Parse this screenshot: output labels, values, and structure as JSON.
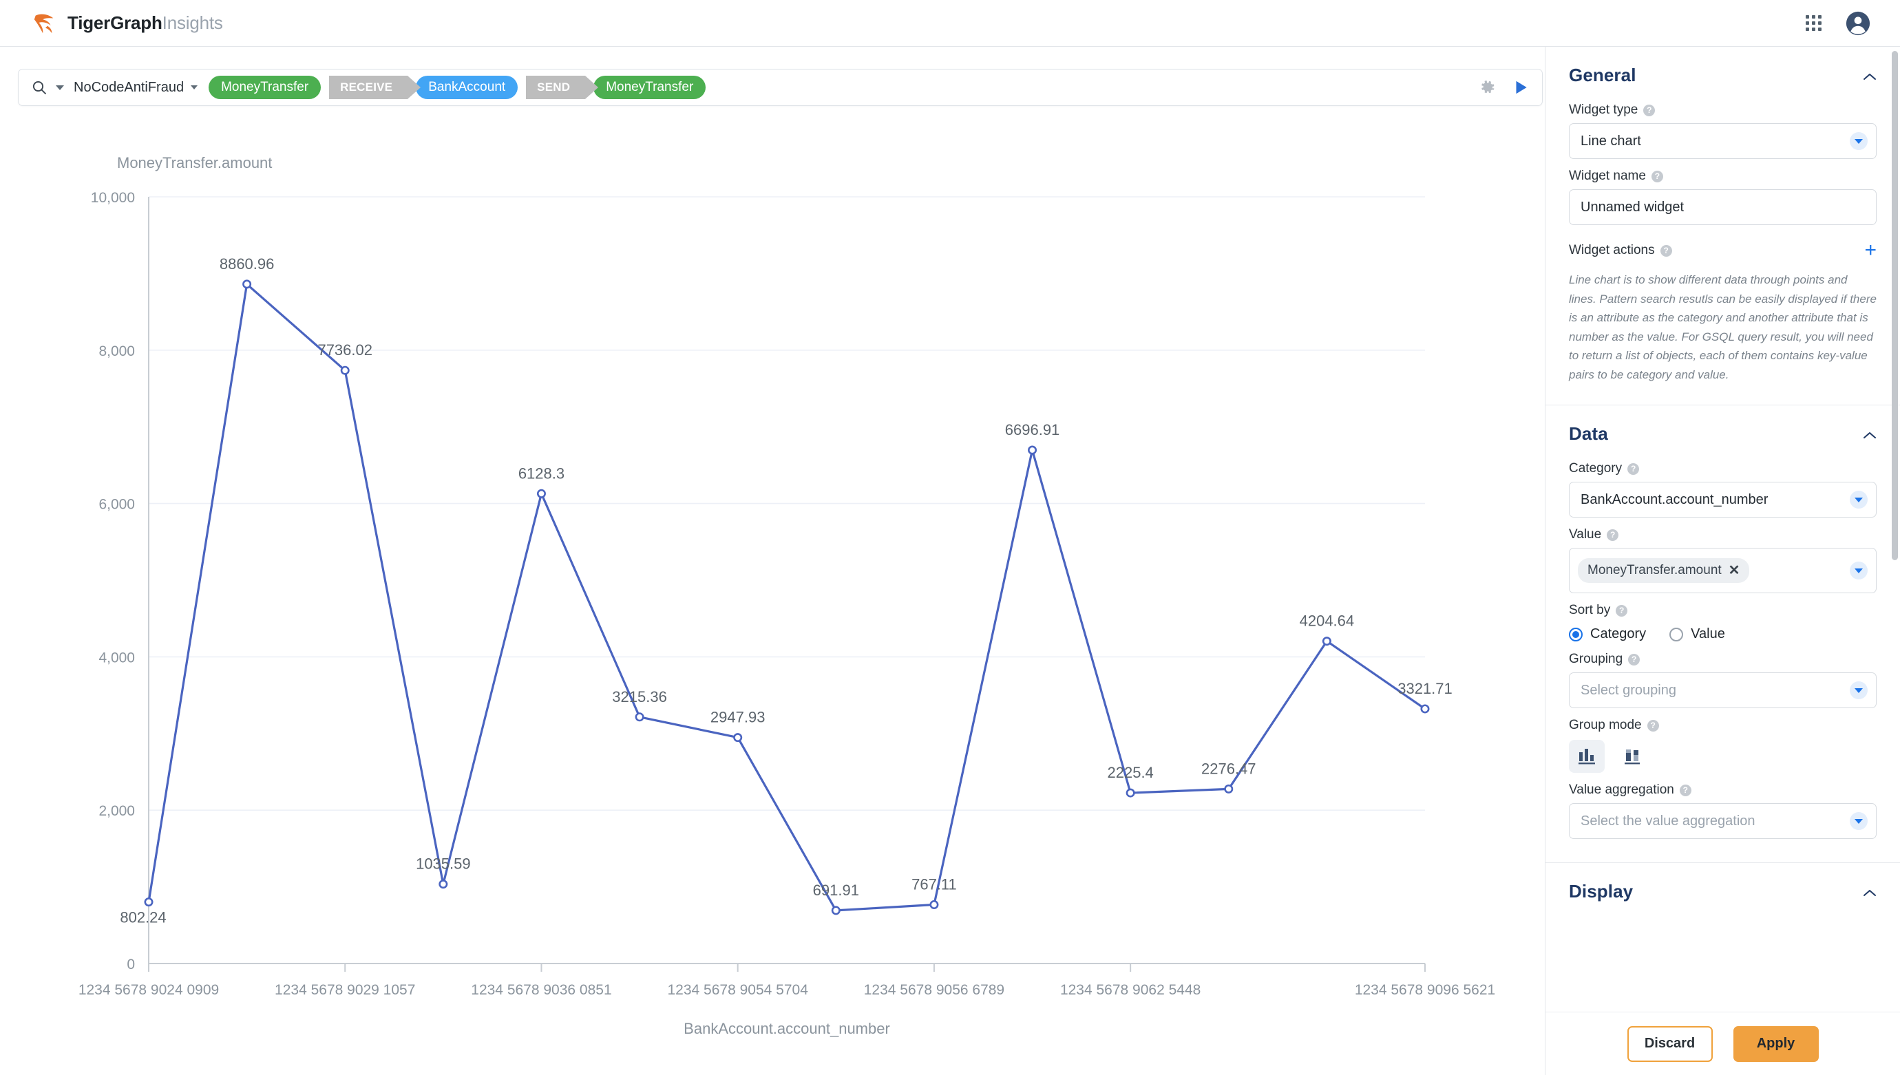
{
  "header": {
    "brand_main": "TigerGraph",
    "brand_light": "Insights",
    "apps_icon": "grid-apps-icon",
    "account_icon": "user-account-icon"
  },
  "search_bar": {
    "search_icon": "search-icon",
    "graph_name": "NoCodeAntiFraud",
    "settings_icon": "gear-icon",
    "run_icon": "play-run-icon",
    "pattern": [
      {
        "kind": "node",
        "label": "MoneyTransfer",
        "color": "#4caf50"
      },
      {
        "kind": "edge",
        "label": "RECEIVE",
        "color": "#bdbdbd"
      },
      {
        "kind": "node",
        "label": "BankAccount",
        "color": "#42a5f5"
      },
      {
        "kind": "edge",
        "label": "SEND",
        "color": "#bdbdbd"
      },
      {
        "kind": "node",
        "label": "MoneyTransfer",
        "color": "#4caf50"
      }
    ]
  },
  "panel": {
    "general": {
      "title": "General",
      "widget_type_label": "Widget type",
      "widget_type_value": "Line chart",
      "widget_name_label": "Widget name",
      "widget_name_value": "Unnamed widget",
      "widget_actions_label": "Widget actions",
      "add_action_label": "+",
      "description": "Line chart is to show different data through points and lines.\nPattern search resutls can be easily displayed if there is an attribute as the category and another attribute that is number as the value.\nFor GSQL query result, you will need to return a list of objects, each of them contains key-value pairs to be category and value."
    },
    "data": {
      "title": "Data",
      "category_label": "Category",
      "category_value": "BankAccount.account_number",
      "value_label": "Value",
      "value_chip": "MoneyTransfer.amount",
      "sort_by_label": "Sort by",
      "sort_options": [
        "Category",
        "Value"
      ],
      "sort_selected": "Category",
      "grouping_label": "Grouping",
      "grouping_placeholder": "Select grouping",
      "group_mode_label": "Group mode",
      "group_mode_selected": "grouped",
      "value_aggregation_label": "Value aggregation",
      "value_aggregation_placeholder": "Select the value aggregation"
    },
    "display": {
      "title": "Display"
    },
    "footer": {
      "discard_label": "Discard",
      "apply_label": "Apply"
    }
  },
  "chart_data": {
    "type": "line",
    "title": "",
    "ylabel": "MoneyTransfer.amount",
    "xlabel": "BankAccount.account_number",
    "ylim": [
      0,
      10000
    ],
    "yticks": [
      0,
      2000,
      4000,
      6000,
      8000,
      10000
    ],
    "ytick_labels": [
      "0",
      "2,000",
      "4,000",
      "6,000",
      "8,000",
      "10,000"
    ],
    "grid": true,
    "legend": "none",
    "line_color": "#4a64c0",
    "xtick_labels": [
      "1234 5678 9024 0909",
      "1234 5678 9029 1057",
      "1234 5678 9036 0851",
      "1234 5678 9054 5704",
      "1234 5678 9056 6789",
      "1234 5678 9062 5448",
      "1234 5678 9096 5621"
    ],
    "xtick_indices": [
      0,
      2,
      4,
      6,
      8,
      10,
      13
    ],
    "values": [
      802.24,
      8860.96,
      7736.02,
      1035.59,
      6128.3,
      3215.36,
      2947.93,
      691.91,
      767.11,
      6696.91,
      2225.4,
      2276.47,
      4204.64,
      3321.71
    ],
    "point_labels": [
      "802.24",
      "8860.96",
      "7736.02",
      "1035.59",
      "6128.3",
      "3215.36",
      "2947.93",
      "691.91",
      "767.11",
      "6696.91",
      "2225.4",
      "2276.47",
      "4204.64",
      "3321.71"
    ],
    "label_offsets": [
      {
        "dx": -8,
        "dy": 30
      },
      {
        "dx": 0,
        "dy": -22
      },
      {
        "dx": 0,
        "dy": -22
      },
      {
        "dx": 0,
        "dy": -22
      },
      {
        "dx": 0,
        "dy": -22
      },
      {
        "dx": 0,
        "dy": -22
      },
      {
        "dx": 0,
        "dy": -22
      },
      {
        "dx": 0,
        "dy": -22
      },
      {
        "dx": 0,
        "dy": -22
      },
      {
        "dx": 0,
        "dy": -22
      },
      {
        "dx": 0,
        "dy": -22
      },
      {
        "dx": 0,
        "dy": -22
      },
      {
        "dx": 0,
        "dy": -22
      },
      {
        "dx": 0,
        "dy": -22
      }
    ]
  }
}
